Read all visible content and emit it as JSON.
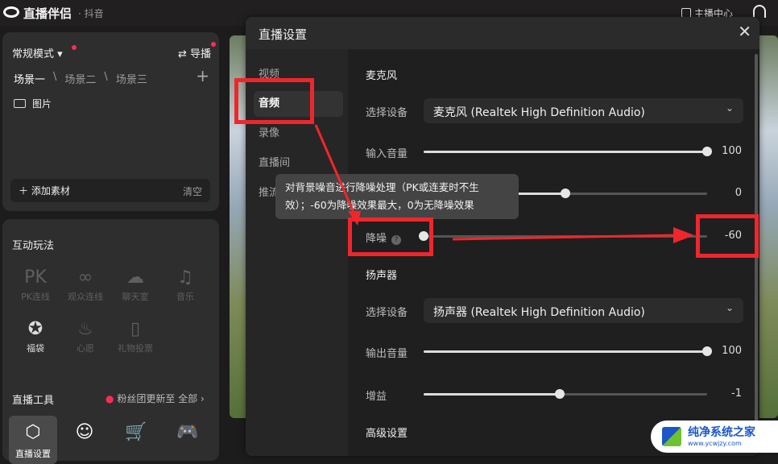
{
  "app": {
    "name": "直播伴侣",
    "platform": "· 抖音",
    "anchor_center": "主播中心"
  },
  "left": {
    "mode": "常规模式",
    "director": "导播",
    "scenes": [
      "场景一",
      "场景二",
      "场景三"
    ],
    "source": "图片",
    "add_material": "添加素材",
    "clear": "清空",
    "interactive_title": "互动玩法",
    "interactive": [
      {
        "icon": "PK",
        "label": "PK连线",
        "enabled": false
      },
      {
        "icon": "∞",
        "label": "观众连线",
        "enabled": false
      },
      {
        "icon": "☁",
        "label": "聊天室",
        "enabled": false
      },
      {
        "icon": "♫",
        "label": "音乐",
        "enabled": false
      },
      {
        "icon": "✪",
        "label": "福袋",
        "enabled": true
      },
      {
        "icon": "♨",
        "label": "心愿",
        "enabled": false
      },
      {
        "icon": "▯",
        "label": "礼物投票",
        "enabled": false
      }
    ],
    "tools_title": "直播工具",
    "tools_notice": "粉丝团更新至",
    "tools_all": "全部 ›",
    "tools": [
      {
        "icon": "⬡",
        "label": "直播设置"
      },
      {
        "icon": "☺",
        "label": ""
      },
      {
        "icon": "🛒",
        "label": ""
      },
      {
        "icon": "🎮",
        "label": ""
      }
    ]
  },
  "dialog": {
    "title": "直播设置",
    "nav": [
      "视频",
      "音频",
      "录像",
      "直播间",
      "推流"
    ],
    "active_nav": "音频",
    "mic": {
      "title": "麦克风",
      "device_label": "选择设备",
      "device": "麦克风 (Realtek High Definition Audio)",
      "input_volume": {
        "label": "输入音量",
        "value": "100",
        "level": 1.0
      },
      "hidden_row": {
        "value": "0",
        "level": 0.5
      },
      "noise": {
        "label": "降噪",
        "value": "-60",
        "level": 0.0
      }
    },
    "speaker": {
      "title": "扬声器",
      "device_label": "选择设备",
      "device": "扬声器 (Realtek High Definition Audio)",
      "output_volume": {
        "label": "输出音量",
        "value": "100",
        "level": 1.0
      },
      "gain": {
        "label": "增益",
        "value": "-1",
        "level": 0.48
      }
    },
    "advanced": "高级设置",
    "tooltip": "对背景噪音进行降噪处理（PK或连麦时不生效）；-60为降噪效果最大，0为无降噪效果"
  },
  "watermark": {
    "name": "纯净系统之家",
    "url": "www.ycwjzy.com"
  },
  "colors": {
    "accent": "#fe2c55",
    "annotation": "#f0262c"
  }
}
